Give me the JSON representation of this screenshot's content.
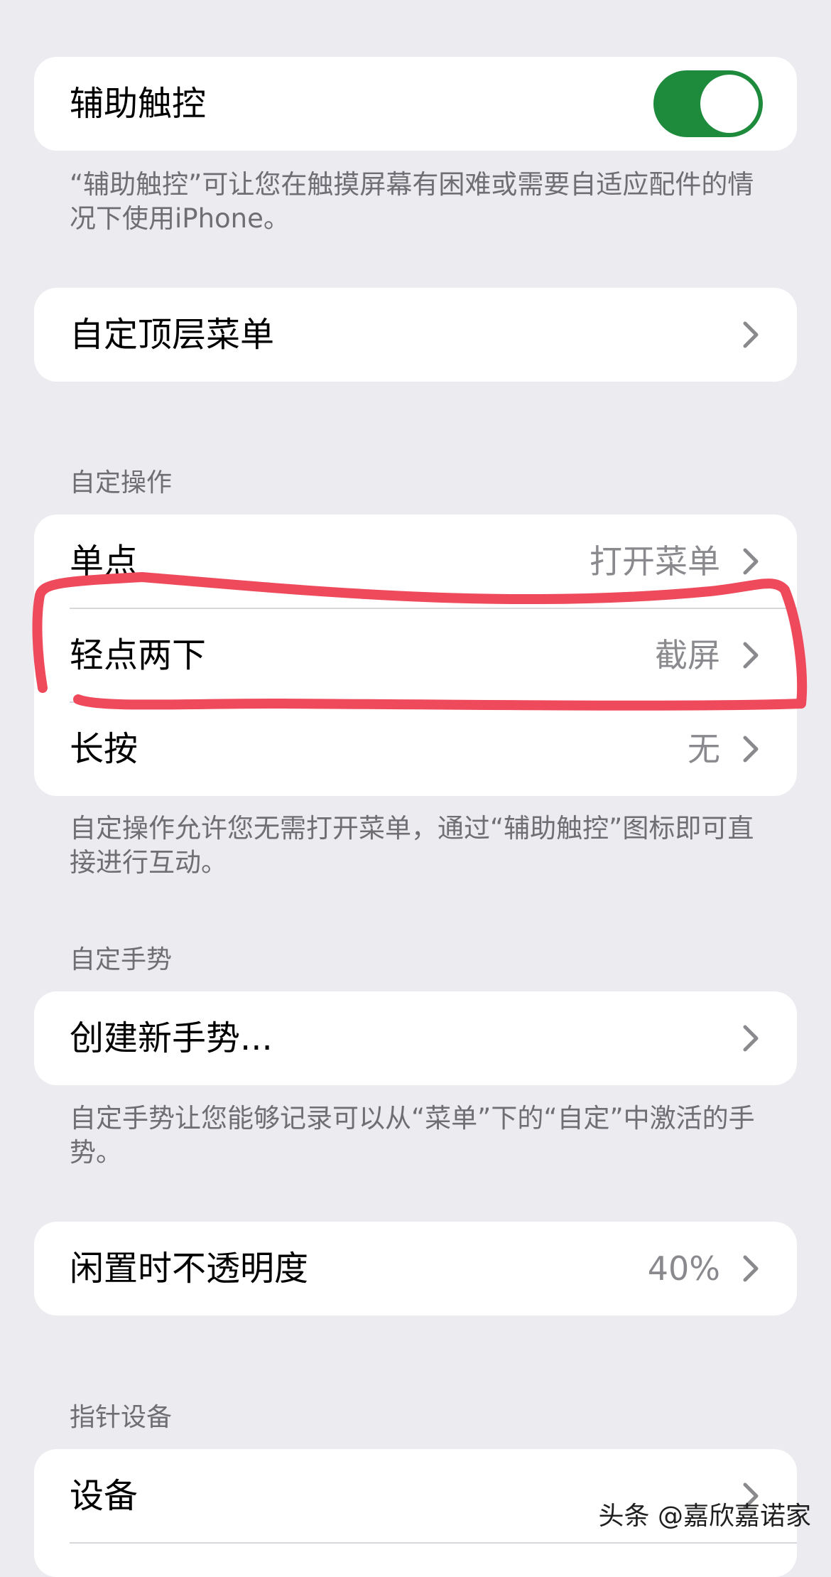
{
  "assistive_touch": {
    "label": "辅助触控",
    "toggle_on": true,
    "footer": "“辅助触控”可让您在触摸屏幕有困难或需要自适应配件的情况下使用iPhone。"
  },
  "top_menu": {
    "label": "自定顶层菜单"
  },
  "custom_actions": {
    "header": "自定操作",
    "items": [
      {
        "label": "单点",
        "value": "打开菜单"
      },
      {
        "label": "轻点两下",
        "value": "截屏"
      },
      {
        "label": "长按",
        "value": "无"
      }
    ],
    "footer": "自定操作允许您无需打开菜单，通过“辅助触控”图标即可直接进行互动。"
  },
  "custom_gestures": {
    "header": "自定手势",
    "create_label": "创建新手势...",
    "footer": "自定手势让您能够记录可以从“菜单”下的“自定”中激活的手势。"
  },
  "idle_opacity": {
    "label": "闲置时不透明度",
    "value": "40%"
  },
  "pointer_devices": {
    "header": "指针设备",
    "items": [
      {
        "label": "设备"
      }
    ]
  },
  "watermark": "头条 @嘉欣嘉诺家",
  "colors": {
    "background": "#ebebf0",
    "toggle_on": "#1e8a3c",
    "annotation": "#ef4a5b",
    "secondary_text": "#6e6e73"
  },
  "icons": {
    "disclosure": "chevron-right-icon"
  }
}
